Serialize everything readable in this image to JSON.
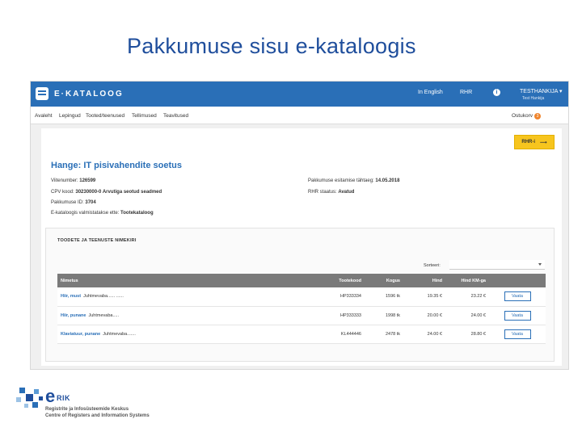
{
  "slide": {
    "title": "Pakkumuse sisu e-kataloogis"
  },
  "topbar": {
    "logo_text": "E·KATALOOG",
    "english_link": "In English",
    "rhr_link": "RHR",
    "info_icon": "i",
    "user_name": "TESTHANKIJA ▾",
    "user_sub": "Test Hankija",
    "bg_color": "#2a6fb7"
  },
  "menu": {
    "items": [
      "Avaleht",
      "Lepingud",
      "Tooted/teenused",
      "Tellimused",
      "Teavitused"
    ],
    "cart_label": "Ostukorv",
    "cart_count": "3",
    "cart_badge_color": "#f0852d"
  },
  "procurement": {
    "rhr_button_label": "RHR-i",
    "rhr_button_arrow": "⟶",
    "rhr_button_color": "#f7c51e",
    "title": "Hange: IT pisivahendite soetus",
    "ref_label": "Viitenumber:",
    "ref_value": "126599",
    "cpv_label": "CPV kood:",
    "cpv_value": "30230000-0 Arvutiga seotud seadmed",
    "offer_id_label": "Pakkumuse ID:",
    "offer_id_value": "3704",
    "prepare_label": "E-kataloogis valmistatakse ette:",
    "prepare_value": "Tootekataloog",
    "deadline_label": "Pakkumuse esitamise tähtaeg:",
    "deadline_value": "14.05.2018",
    "status_label": "RHR staatus:",
    "status_value": "Avatud"
  },
  "products": {
    "heading": "TOODETE JA TEENUSTE NIMEKIRI",
    "sort_label": "Sorteeri:",
    "sort_value": "",
    "columns": [
      "Nimetus",
      "Tootekood",
      "Kogus",
      "Hind",
      "Hind KM-ga",
      ""
    ],
    "rows": [
      {
        "name": "Hiir, must",
        "desc": "Juhtmevaba...... ......",
        "code": "HP333334",
        "qty": "1596 tk",
        "price": "19.35 €",
        "price_vat": "23.22 €",
        "action": "Vaata"
      },
      {
        "name": "Hiir, punane",
        "desc": "Juhtmevaba.....",
        "code": "HP333333",
        "qty": "1998 tk",
        "price": "20.00 €",
        "price_vat": "24.00 €",
        "action": "Vaata"
      },
      {
        "name": "Klaviatuur, punane",
        "desc": "Juhtmevaba.......",
        "code": "KL444446",
        "qty": "2478 tk",
        "price": "24.00 €",
        "price_vat": "28.80 €",
        "action": "Vaata"
      }
    ],
    "header_color": "#7a7a7a"
  },
  "footer": {
    "logo_e": "e",
    "logo_rik": "RIK",
    "line1": "Registrite ja Infosüsteemide Keskus",
    "line2": "Centre of Registers and Information Systems",
    "brand_color": "#1f4e9c"
  }
}
